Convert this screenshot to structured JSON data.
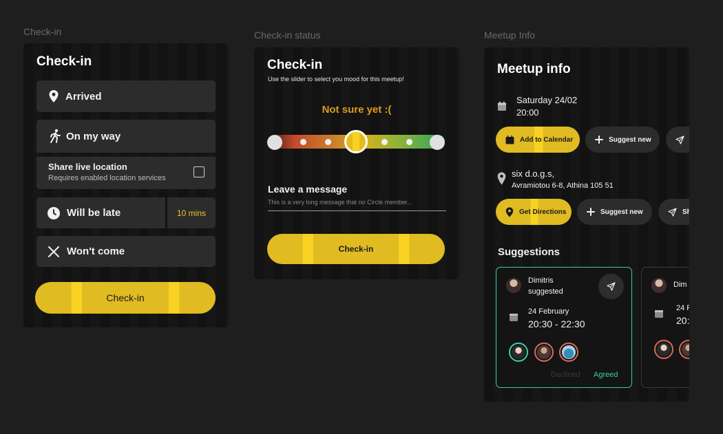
{
  "frames": {
    "checkin": "Check-in",
    "status": "Check-in status",
    "meetup": "Meetup Info"
  },
  "checkin": {
    "title": "Check-in",
    "options": {
      "arrived": "Arrived",
      "on_my_way": "On my way",
      "share_title": "Share live location",
      "share_sub": "Requires enabled location services",
      "will_be_late": "Will be late",
      "late_minutes": "10 mins",
      "wont_come": "Won't come"
    },
    "button": "Check-in"
  },
  "status": {
    "title": "Check-in",
    "subtitle": "Use the slider to select you mood for this meetup!",
    "mood": "Not sure yet :(",
    "slider_level": 0.5,
    "message_label": "Leave a message",
    "message_value": "This is a very long message that no Circle member...",
    "button": "Check-in"
  },
  "meetup": {
    "title": "Meetup info",
    "date": "Saturday 24/02",
    "time": "20:00",
    "actions_row1": [
      "Add to Calendar",
      "Suggest new",
      "S"
    ],
    "location_name": "six d.o.g.s,",
    "location_address": "Avramiotou 6-8, Athina 105 51",
    "actions_row2": [
      "Get Directions",
      "Suggest new",
      "Sh"
    ],
    "suggestions_title": "Suggestions",
    "suggestions": [
      {
        "name": "Dimitris",
        "verb": "suggested",
        "date": "24 February",
        "time": "20:30 - 22:30",
        "declined": "Declined",
        "agreed": "Agreed"
      },
      {
        "name": "Dim",
        "date": "24 F",
        "time": "20:"
      }
    ]
  },
  "colors": {
    "accent_yellow": "#e0bb22",
    "mood_orange": "#dc9b1d",
    "agreed_green": "#3ad0a4",
    "background": "#1e1e1e"
  }
}
